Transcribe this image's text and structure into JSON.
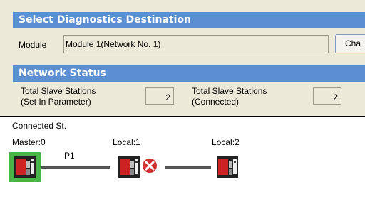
{
  "diagnostics_destination": {
    "header": "Select Diagnostics Destination",
    "module_label": "Module",
    "module_value": "Module 1(Network No. 1)",
    "change_button_label": "Cha"
  },
  "network_status": {
    "header": "Network Status",
    "total_in_parameter_label_line1": "Total Slave Stations",
    "total_in_parameter_label_line2": "(Set In Parameter)",
    "total_in_parameter_value": "2",
    "total_connected_label_line1": "Total Slave Stations",
    "total_connected_label_line2": "(Connected)",
    "total_connected_value": "2"
  },
  "network_map": {
    "connected_label": "Connected St.",
    "port_label": "P1",
    "stations": [
      {
        "label": "Master:0",
        "status": "selected"
      },
      {
        "label": "Local:1",
        "status": "error"
      },
      {
        "label": "Local:2",
        "status": "normal"
      }
    ]
  },
  "colors": {
    "section_header": "#5c8fd2",
    "selected_station": "#48b548",
    "error_badge": "#d03030",
    "plc_red": "#cc2222"
  }
}
